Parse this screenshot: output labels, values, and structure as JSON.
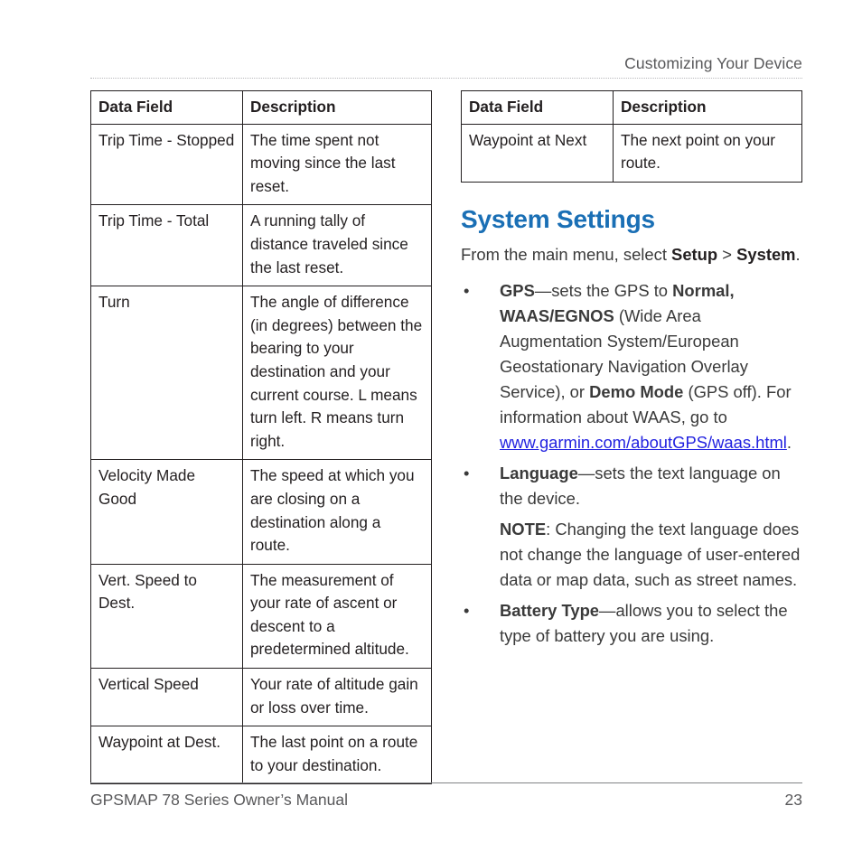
{
  "header": {
    "running_title": "Customizing Your Device"
  },
  "left_table": {
    "columns": [
      "Data Field",
      "Description"
    ],
    "rows": [
      {
        "field": "Trip Time - Stopped",
        "description": "The time spent not moving since the last reset."
      },
      {
        "field": "Trip Time - Total",
        "description": "A running tally of distance traveled since the last reset."
      },
      {
        "field": "Turn",
        "description": "The angle of difference (in degrees) between the bearing to your destination and your current course. L means turn left. R means turn right."
      },
      {
        "field": "Velocity Made Good",
        "description": "The speed at which you are closing on a destination along a route."
      },
      {
        "field": "Vert. Speed to Dest.",
        "description": "The measurement of your rate of ascent or descent to a predetermined altitude."
      },
      {
        "field": "Vertical Speed",
        "description": "Your rate of altitude gain or loss over time."
      },
      {
        "field": "Waypoint at Dest.",
        "description": "The last point on a route to your destination."
      }
    ]
  },
  "right_table": {
    "columns": [
      "Data Field",
      "Description"
    ],
    "rows": [
      {
        "field": "Waypoint at Next",
        "description": "The next point on your route."
      }
    ]
  },
  "section": {
    "title": "System Settings",
    "title_color": "#1a6fb5",
    "intro": {
      "lead": "From the main menu, select ",
      "bold1": "Setup",
      "middle": " > ",
      "bold2": "System",
      "tail": "."
    },
    "bullet_glyph": "•",
    "bullets": [
      {
        "term": "GPS",
        "text_1": "—sets the GPS to ",
        "bold_1": "Normal, WAAS/EGNOS",
        "text_2": " (Wide Area Augmentation System/European Geostationary Navigation Overlay Service), or ",
        "bold_2": "Demo Mode",
        "text_3": " (GPS off). For information about WAAS, go to ",
        "link": "www.garmin.com/aboutGPS/waas.html",
        "link_color": "#2222e0",
        "text_4": "."
      },
      {
        "term": "Language",
        "text_1": "—sets the text language on the device."
      },
      {
        "term": "Battery Type",
        "text_1": "—allows you to select the type of battery you are using."
      }
    ],
    "note": {
      "label": "NOTE",
      "text": ": Changing the text language does not change the language of user-entered data or map data, such as street names."
    }
  },
  "footer": {
    "manual_title": "GPSMAP 78 Series Owner’s Manual",
    "page_number": "23"
  }
}
